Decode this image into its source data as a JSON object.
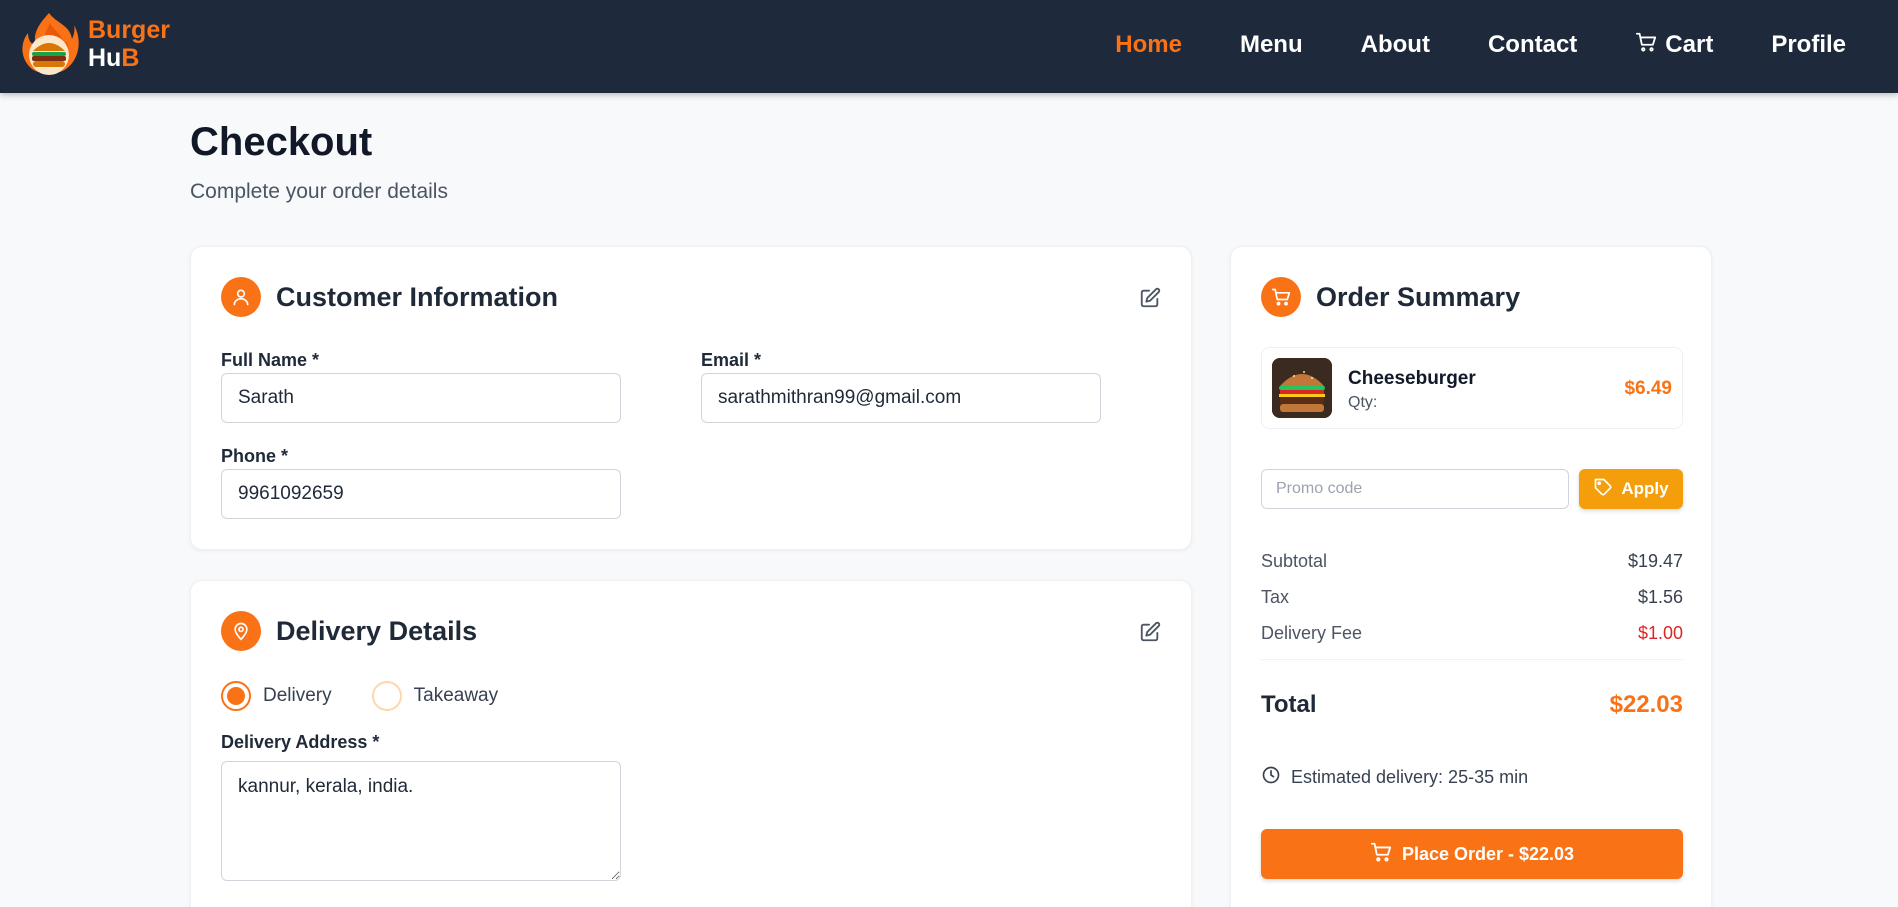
{
  "brand": {
    "line1": "Burger",
    "line2_main": "Hu",
    "line2_accent": "B",
    "logo_icon": "burger-flame-logo"
  },
  "nav": {
    "items": [
      {
        "label": "Home",
        "active": true
      },
      {
        "label": "Menu",
        "active": false
      },
      {
        "label": "About",
        "active": false
      },
      {
        "label": "Contact",
        "active": false
      },
      {
        "label": "Cart",
        "active": false,
        "icon": "cart-icon"
      },
      {
        "label": "Profile",
        "active": false
      }
    ]
  },
  "page": {
    "title": "Checkout",
    "subtitle": "Complete your order details"
  },
  "customer": {
    "title": "Customer Information",
    "icon": "user-icon",
    "full_name_label": "Full Name *",
    "full_name_value": "Sarath",
    "email_label": "Email *",
    "email_value": "sarathmithran99@gmail.com",
    "phone_label": "Phone *",
    "phone_value": "9961092659"
  },
  "delivery": {
    "title": "Delivery Details",
    "icon": "map-pin-icon",
    "options": [
      "Delivery",
      "Takeaway"
    ],
    "selected": "Delivery",
    "address_label": "Delivery Address *",
    "address_value": "kannur, kerala, india."
  },
  "summary": {
    "title": "Order Summary",
    "icon": "cart-icon",
    "items": [
      {
        "name": "Cheeseburger",
        "qty_label": "Qty:",
        "price": "$6.49"
      }
    ],
    "promo_placeholder": "Promo code",
    "apply_label": "Apply",
    "subtotal_label": "Subtotal",
    "subtotal_value": "$19.47",
    "tax_label": "Tax",
    "tax_value": "$1.56",
    "fee_label": "Delivery Fee",
    "fee_value": "$1.00",
    "total_label": "Total",
    "total_value": "$22.03",
    "eta_text": "Estimated delivery: 25-35 min",
    "place_order_label": "Place Order - $22.03"
  },
  "colors": {
    "accent": "#f97316",
    "navbar": "#1e293b",
    "apply": "#f59e0b",
    "fee": "#dc2626"
  }
}
